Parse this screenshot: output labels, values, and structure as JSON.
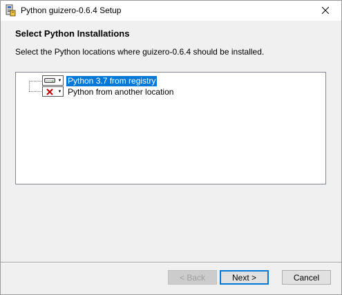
{
  "window": {
    "title": "Python guizero-0.6.4 Setup"
  },
  "header": {
    "heading": "Select Python Installations",
    "description": "Select the Python locations where guizero-0.6.4 should be installed."
  },
  "tree": {
    "items": [
      {
        "label": "Python 3.7 from registry",
        "state": "installed",
        "icon": "drive-icon",
        "selected": true
      },
      {
        "label": "Python from another location",
        "state": "not-installed",
        "icon": "red-x-icon",
        "selected": false
      }
    ]
  },
  "buttons": {
    "back": "< Back",
    "next": "Next >",
    "cancel": "Cancel"
  },
  "colors": {
    "selection": "#0078d7",
    "window_bg": "#f0f0f0",
    "red_x": "#c00000"
  }
}
